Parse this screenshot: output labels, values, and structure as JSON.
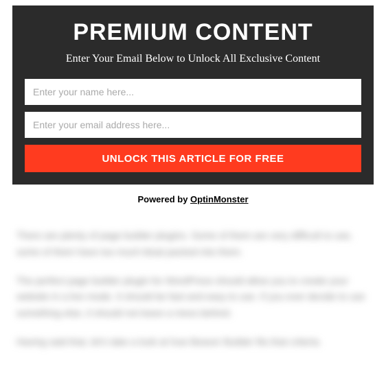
{
  "optin": {
    "title": "PREMIUM CONTENT",
    "subtitle": "Enter Your Email Below to Unlock All Exclusive Content",
    "name_placeholder": "Enter your name here...",
    "email_placeholder": "Enter your email address here...",
    "button_label": "UNLOCK THIS ARTICLE FOR FREE"
  },
  "powered_by": {
    "prefix": "Powered by ",
    "brand": "OptinMonster"
  },
  "blurred": {
    "p1": "There are plenty of page builder plugins. Some of them are very difficult to use, some of them have too much bloat packed into them.",
    "p2": "The perfect page builder plugin for WordPress should allow you to create your website in a live mode. It should be fast and easy to use. If you ever decide to use something else, it should not leave a mess behind.",
    "p3": "Having said that, let's take a look at how Beaver Builder fits that criteria."
  }
}
